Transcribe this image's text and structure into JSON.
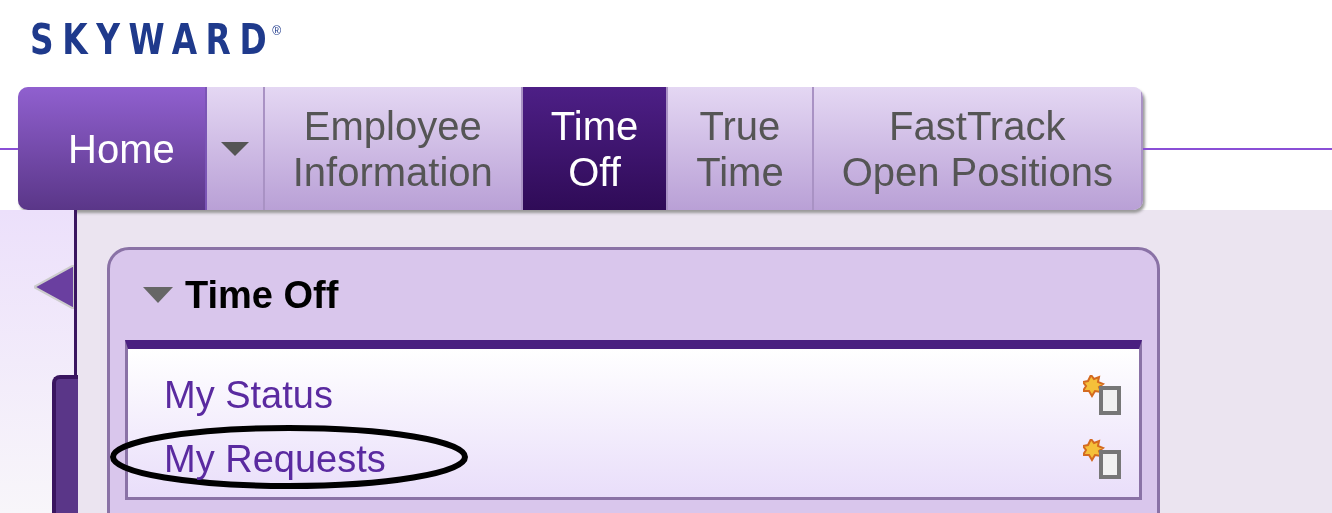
{
  "logo": {
    "text": "SKYWARD",
    "mark": "®"
  },
  "tabs": [
    {
      "kind": "home",
      "label": "Home",
      "selected": false
    },
    {
      "kind": "dropdown",
      "selected": false
    },
    {
      "kind": "tab",
      "label": "Employee\nInformation",
      "selected": false
    },
    {
      "kind": "tab",
      "label": "Time\nOff",
      "selected": true
    },
    {
      "kind": "tab",
      "label": "True\nTime",
      "selected": false
    },
    {
      "kind": "tab",
      "label": "FastTrack\nOpen Positions",
      "selected": false
    }
  ],
  "panel": {
    "title": "Time Off",
    "expanded": true,
    "items": [
      {
        "label": "My Status",
        "circled": false
      },
      {
        "label": "My Requests",
        "circled": true
      }
    ]
  }
}
